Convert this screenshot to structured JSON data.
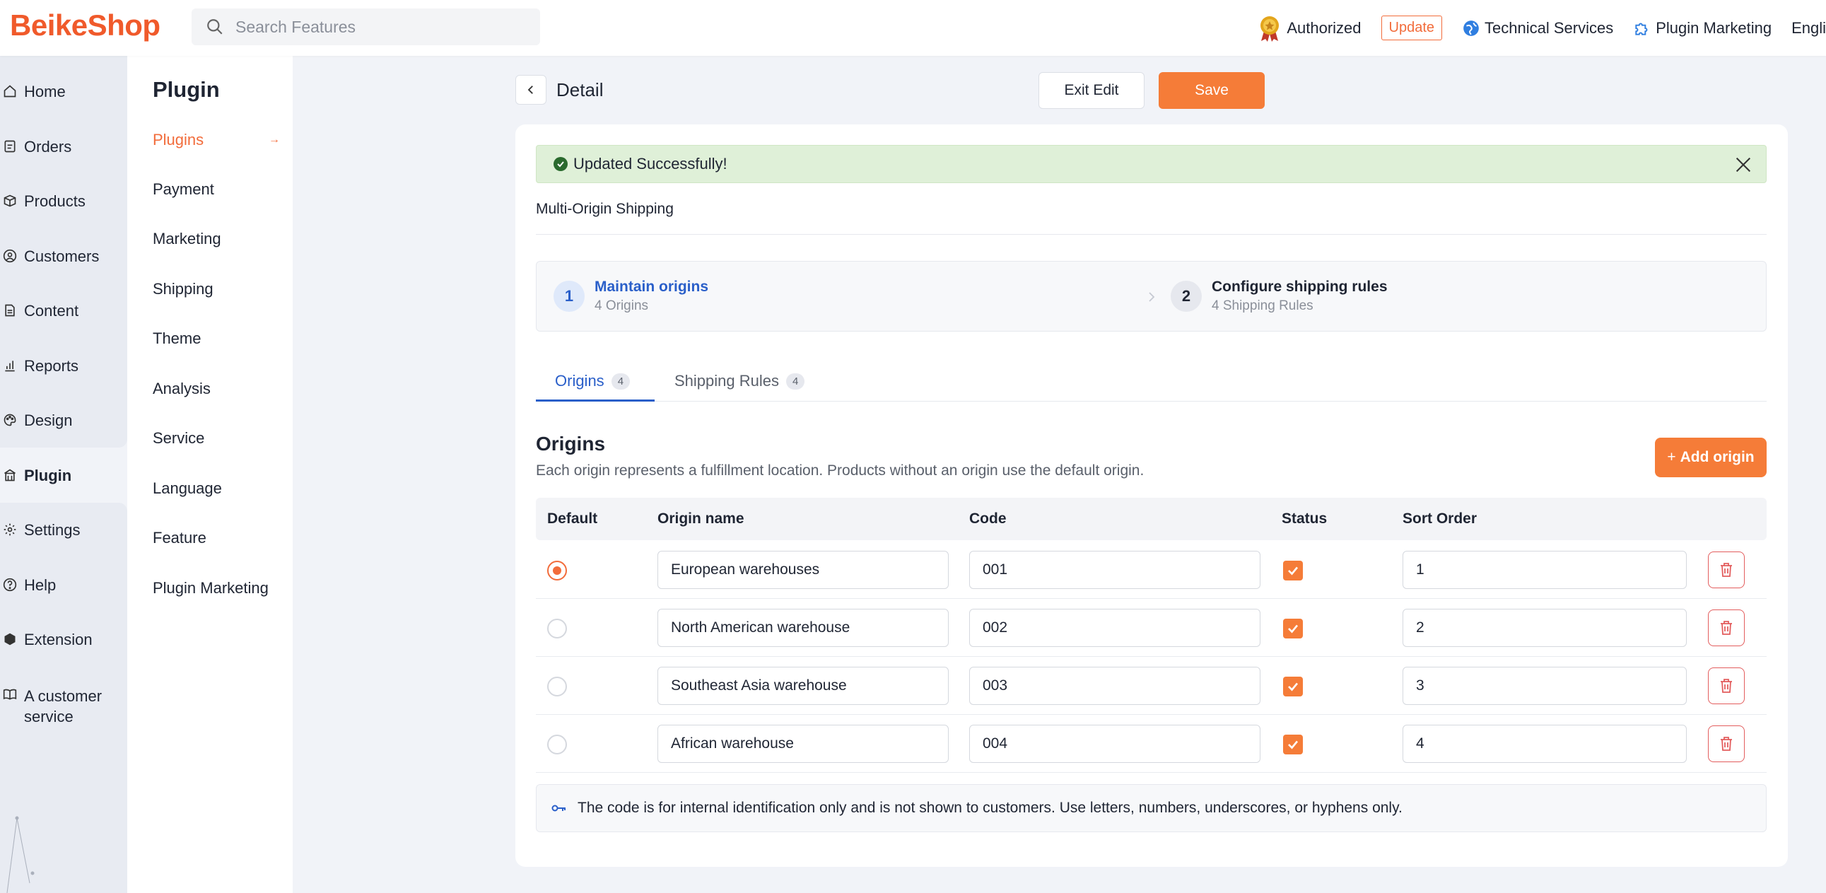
{
  "header": {
    "logo": "BeikeShop",
    "search_placeholder": "Search Features",
    "authorized": "Authorized",
    "update": "Update",
    "technical_services": "Technical Services",
    "plugin_marketing": "Plugin Marketing",
    "language": "Engli"
  },
  "sidebar": {
    "items": [
      {
        "label": "Home",
        "icon": "home-icon"
      },
      {
        "label": "Orders",
        "icon": "orders-icon"
      },
      {
        "label": "Products",
        "icon": "box-icon"
      },
      {
        "label": "Customers",
        "icon": "user-icon"
      },
      {
        "label": "Content",
        "icon": "document-icon"
      },
      {
        "label": "Reports",
        "icon": "chart-icon"
      },
      {
        "label": "Design",
        "icon": "palette-icon"
      },
      {
        "label": "Plugin",
        "icon": "plugin-icon"
      },
      {
        "label": "Settings",
        "icon": "gear-icon"
      },
      {
        "label": "Help",
        "icon": "help-icon"
      },
      {
        "label": "Extension",
        "icon": "cube-icon"
      },
      {
        "label": "A customer service",
        "icon": "book-icon"
      }
    ]
  },
  "subnav": {
    "title": "Plugin",
    "items": [
      "Plugins",
      "Payment",
      "Marketing",
      "Shipping",
      "Theme",
      "Analysis",
      "Service",
      "Language",
      "Feature",
      "Plugin Marketing"
    ]
  },
  "page": {
    "title": "Detail",
    "exit_edit": "Exit Edit",
    "save": "Save"
  },
  "alert": {
    "message": "Updated Successfully!"
  },
  "plugin_title": "Multi-Origin Shipping",
  "steps": [
    {
      "num": "1",
      "title": "Maintain origins",
      "sub": "4 Origins"
    },
    {
      "num": "2",
      "title": "Configure shipping rules",
      "sub": "4 Shipping Rules"
    }
  ],
  "tabs": [
    {
      "label": "Origins",
      "count": "4"
    },
    {
      "label": "Shipping Rules",
      "count": "4"
    }
  ],
  "origins": {
    "title": "Origins",
    "description": "Each origin represents a fulfillment location. Products without an origin use the default origin.",
    "add_button": "Add origin",
    "columns": [
      "Default",
      "Origin name",
      "Code",
      "Status",
      "Sort Order"
    ],
    "rows": [
      {
        "default": true,
        "name": "European warehouses",
        "code": "001",
        "status": true,
        "sort": "1"
      },
      {
        "default": false,
        "name": "North American warehouse",
        "code": "002",
        "status": true,
        "sort": "2"
      },
      {
        "default": false,
        "name": "Southeast Asia warehouse",
        "code": "003",
        "status": true,
        "sort": "3"
      },
      {
        "default": false,
        "name": "African warehouse",
        "code": "004",
        "status": true,
        "sort": "4"
      }
    ],
    "note": "The code is for internal identification only and is not shown to customers. Use letters, numbers, underscores, or hyphens only."
  },
  "colors": {
    "brand": "#f05a2b",
    "accent": "#f57c38",
    "primary_blue": "#2a5fc9",
    "success_bg": "#dff0d8"
  }
}
